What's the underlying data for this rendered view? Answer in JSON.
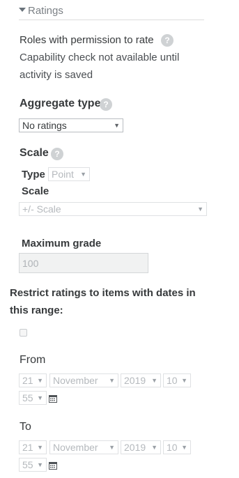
{
  "header": {
    "title": "Ratings"
  },
  "roles": {
    "label": "Roles with permission to rate",
    "note_line1": "Capability check not available until",
    "note_line2": "activity is saved"
  },
  "aggregate": {
    "label": "Aggregate type",
    "value": "No ratings"
  },
  "scale": {
    "label": "Scale",
    "type_label": "Type",
    "type_value": "Point",
    "scale_label": "Scale",
    "scale_value": "+/- Scale"
  },
  "max_grade": {
    "label": "Maximum grade",
    "value": "100"
  },
  "restrict": {
    "line1": "Restrict ratings to items with dates in",
    "line2": "this range:"
  },
  "from": {
    "label": "From",
    "day": "21",
    "month": "November",
    "year": "2019",
    "hour": "10",
    "minute": "55"
  },
  "to": {
    "label": "To",
    "day": "21",
    "month": "November",
    "year": "2019",
    "hour": "10",
    "minute": "55"
  },
  "help_glyph": "?",
  "caret_glyph": "▼"
}
